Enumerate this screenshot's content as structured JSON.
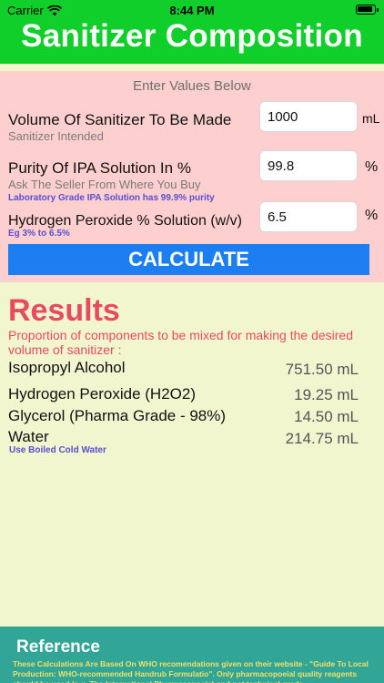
{
  "status": {
    "carrier": "Carrier",
    "time": "8:44 PM"
  },
  "header": {
    "title": "Sanitizer Composition"
  },
  "form": {
    "hint": "Enter Values Below",
    "volume": {
      "label": "Volume Of Sanitizer To Be Made",
      "sub": "Sanitizer Intended",
      "value": "1000",
      "unit": "mL"
    },
    "purity": {
      "label": "Purity Of IPA Solution In %",
      "sub": "Ask The Seller From Where You Buy",
      "note": "Laboratory Grade IPA Solution has 99.9% purity",
      "value": "99.8",
      "unit": "%"
    },
    "peroxide": {
      "label": "Hydrogen Peroxide % Solution (w/v)",
      "note": "Eg 3% to 6.5%",
      "value": "6.5",
      "unit": "%"
    },
    "calculate_label": "CALCULATE"
  },
  "results": {
    "title": "Results",
    "description": "Proportion of components to be mixed for making the desired volume of sanitizer :",
    "rows": [
      {
        "label": "Isopropyl Alcohol",
        "value": "751.50 mL"
      },
      {
        "label": "Hydrogen Peroxide (H2O2)",
        "value": "19.25 mL"
      },
      {
        "label": "Glycerol (Pharma Grade - 98%)",
        "value": "14.50 mL"
      },
      {
        "label": "Water",
        "value": "214.75 mL",
        "note": "Use Boiled Cold Water"
      }
    ]
  },
  "reference": {
    "title": "Reference",
    "body": "These Calculations Are Based On WHO recomendations given on their website - \"Guide To Local Production: WHO-recommended Handrub Formulatio\". Only pharmacopoeial quality reagents should be used (e.g. The International Pharmacopoeia) and not technical grade"
  },
  "colors": {
    "header_bg": "#10cf2a",
    "input_panel_bg": "#fecfcf",
    "results_bg": "#f1f6cf",
    "button_bg": "#1d7ef2",
    "results_accent": "#e84a5f",
    "note_color": "#5a4ed1",
    "reference_bg": "#31a596",
    "reference_text": "#f1e06a"
  },
  "icons": [
    "wifi-icon",
    "battery-icon"
  ]
}
